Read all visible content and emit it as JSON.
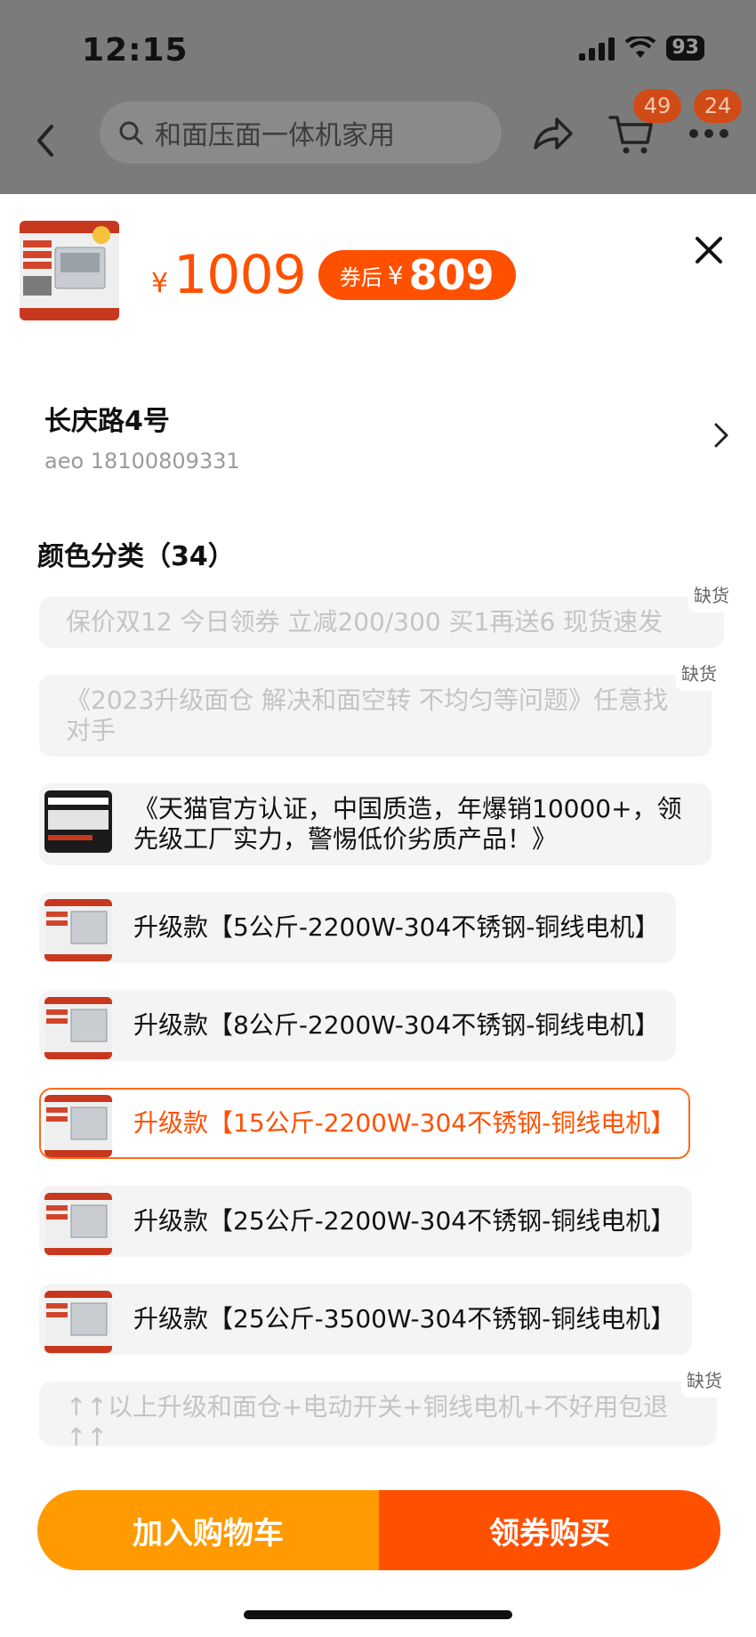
{
  "status_bar": {
    "time": "12:15",
    "battery": "93"
  },
  "nav": {
    "search_placeholder": "和面压面一体机家用",
    "cart_badge": "49",
    "more_badge": "24"
  },
  "sheet": {
    "currency": "¥",
    "price": "1009",
    "coupon_label": "券后",
    "coupon_currency": "¥",
    "coupon_price": "809",
    "address": {
      "name": "长庆路4号",
      "contact": "aeo 18100809331"
    },
    "section_title": "颜色分类（34）",
    "out_of_stock": "缺货",
    "options": [
      {
        "label": "保价双12 今日领券 立减200/300 买1再送6 现货速发",
        "state": "disabled",
        "has_image": false
      },
      {
        "label": "《2023升级面仓 解决和面空转 不均匀等问题》任意找对手",
        "state": "disabled",
        "has_image": false
      },
      {
        "label": "《天猫官方认证，中国质造，年爆销10000+，领先级工厂实力，警惕低价劣质产品！》",
        "state": "normal",
        "has_image": true
      },
      {
        "label": "升级款【5公斤-2200W-304不锈钢-铜线电机】",
        "state": "normal",
        "has_image": true
      },
      {
        "label": "升级款【8公斤-2200W-304不锈钢-铜线电机】",
        "state": "normal",
        "has_image": true
      },
      {
        "label": "升级款【15公斤-2200W-304不锈钢-铜线电机】",
        "state": "selected",
        "has_image": true
      },
      {
        "label": "升级款【25公斤-2200W-304不锈钢-铜线电机】",
        "state": "normal",
        "has_image": true
      },
      {
        "label": "升级款【25公斤-3500W-304不锈钢-铜线电机】",
        "state": "normal",
        "has_image": true
      },
      {
        "label": "↑↑以上升级和面仓+电动开关+铜线电机+不好用包退↑↑",
        "state": "disabled",
        "has_image": false
      }
    ],
    "add_to_cart": "加入购物车",
    "buy_with_coupon": "领券购买"
  },
  "colors": {
    "accent": "#ff5000",
    "secondary": "#ff9a00"
  }
}
